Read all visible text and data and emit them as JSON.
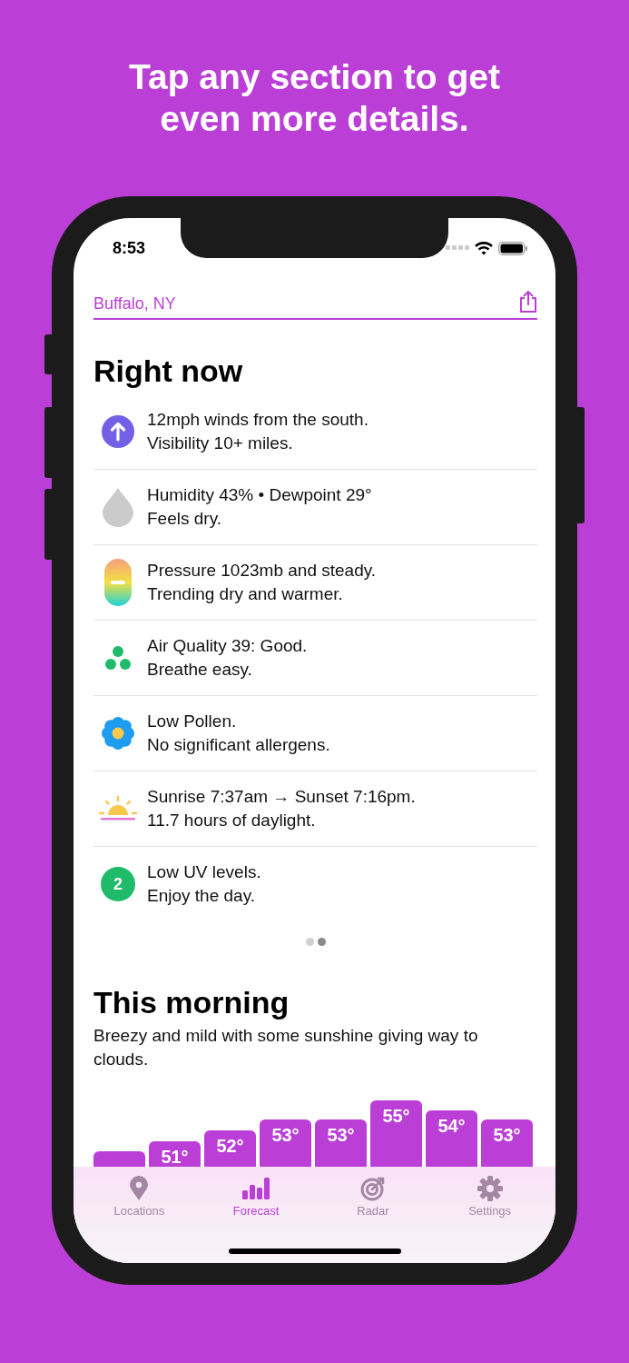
{
  "headline": "Tap any section to get even more details.",
  "status_bar": {
    "time": "8:53"
  },
  "location": {
    "name": "Buffalo, NY"
  },
  "right_now": {
    "title": "Right now",
    "items": [
      {
        "kind": "wind",
        "lines": [
          "12mph winds from the south.",
          "Visibility 10+ miles."
        ]
      },
      {
        "kind": "humidity",
        "lines": [
          "Humidity 43% • Dewpoint 29°",
          "Feels dry."
        ]
      },
      {
        "kind": "pressure",
        "lines": [
          "Pressure 1023mb and steady.",
          "Trending dry and warmer."
        ]
      },
      {
        "kind": "air",
        "lines": [
          "Air Quality 39: Good.",
          "Breathe easy."
        ]
      },
      {
        "kind": "pollen",
        "lines": [
          "Low Pollen.",
          "No significant allergens."
        ]
      },
      {
        "kind": "sun",
        "lines": [
          "Sunrise 7:37am → Sunset 7:16pm.",
          "11.7 hours of daylight."
        ]
      },
      {
        "kind": "uv",
        "badge": "2",
        "lines": [
          "Low UV levels.",
          "Enjoy the day."
        ]
      }
    ]
  },
  "pager": [
    {
      "selected": false
    },
    {
      "selected": true
    }
  ],
  "this_morning": {
    "title": "This morning",
    "summary": "Breezy and mild with some sunshine giving way to clouds.",
    "hourly": [
      {
        "level": 0.23
      },
      {
        "temp": "51°",
        "level": 0.37
      },
      {
        "temp": "52°",
        "level": 0.53
      },
      {
        "temp": "53°",
        "level": 0.69
      },
      {
        "temp": "53°",
        "level": 0.69
      },
      {
        "temp": "55°",
        "level": 0.97
      },
      {
        "temp": "54°",
        "level": 0.83
      },
      {
        "temp": "53°",
        "level": 0.69
      }
    ]
  },
  "tabs": [
    {
      "kind": "pin",
      "label": "Locations",
      "selected": false
    },
    {
      "kind": "bars",
      "label": "Forecast",
      "selected": true
    },
    {
      "kind": "radar",
      "label": "Radar",
      "selected": false
    },
    {
      "kind": "gear",
      "label": "Settings",
      "selected": false
    }
  ]
}
